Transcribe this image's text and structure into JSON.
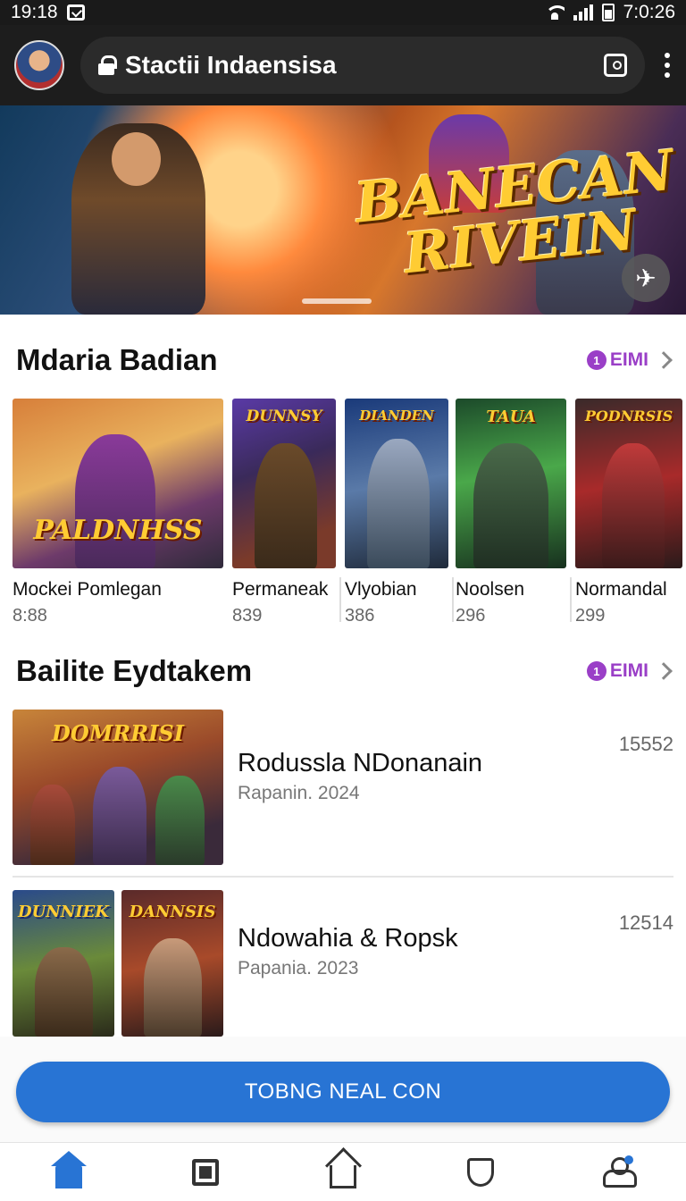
{
  "status_bar": {
    "time_left": "19:18",
    "time_right": "7:0:26"
  },
  "browser": {
    "url": "Stactii Indaensisa"
  },
  "hero": {
    "title_line1": "BANECAN",
    "title_line2": "RIVEIN"
  },
  "section1": {
    "title": "Mdaria Badian",
    "see_all": "EIMI",
    "cards": [
      {
        "label": "Mockei Pomlegan",
        "count": "8:88",
        "art_title": "PALDNHSS"
      },
      {
        "label": "Permaneak",
        "count": "839",
        "art_title": "DUNNSY"
      },
      {
        "label": "Vlyobian",
        "count": "386",
        "art_title": "DIANDEN"
      },
      {
        "label": "Noolsen",
        "count": "296",
        "art_title": "TAUA"
      },
      {
        "label": "Normandal",
        "count": "299",
        "art_title": "PODNRSIS"
      }
    ]
  },
  "section2": {
    "title": "Bailite Eydtakem",
    "see_all": "EIMI",
    "items": [
      {
        "title": "Rodussla NDonanain",
        "subtitle": "Rapanin. 2024",
        "number": "15552",
        "art_title": "DOMRRISI"
      },
      {
        "title": "Ndowahia & Ropsk",
        "subtitle": "Papania. 2023",
        "number": "12514",
        "art_title_a": "DUNNIEK",
        "art_title_b": "DANNSIS"
      }
    ]
  },
  "cta": {
    "label": "TOBNG NEAL CON"
  },
  "colors": {
    "accent": "#2874d4",
    "see_all": "#9a3fc7"
  }
}
